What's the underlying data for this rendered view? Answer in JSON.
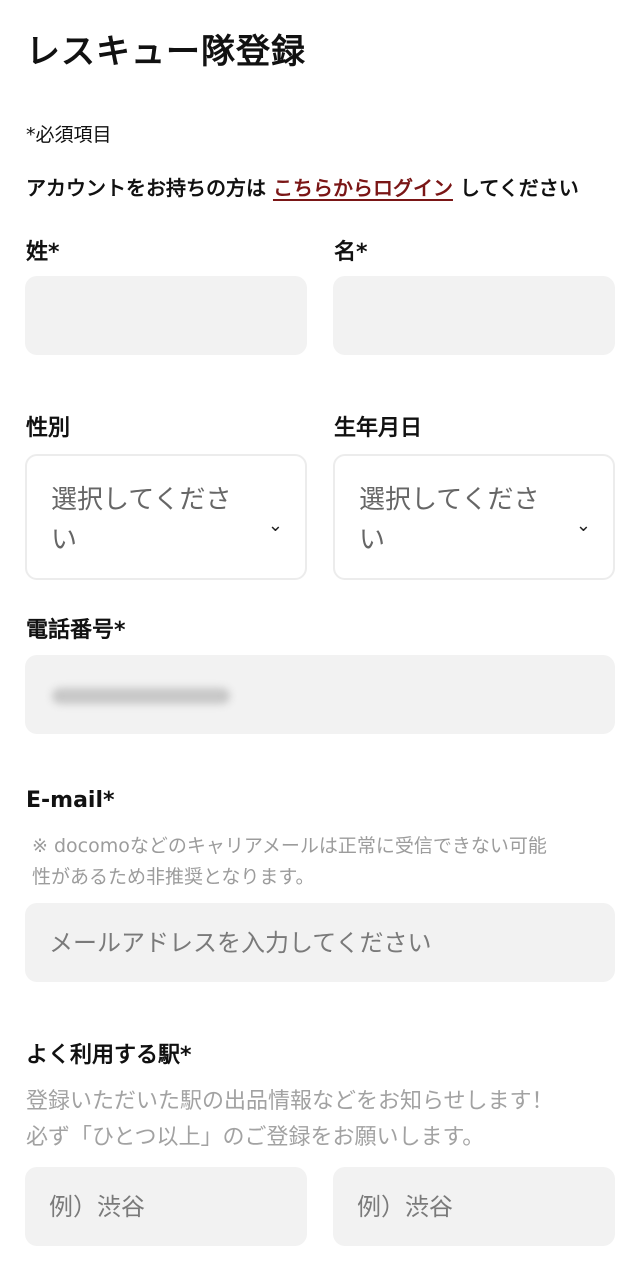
{
  "header": {
    "title": "レスキュー隊登録"
  },
  "required_note": "*必須項目",
  "login": {
    "prefix": "アカウントをお持ちの方は ",
    "link": "こちらからログイン",
    "suffix": " してください"
  },
  "fields": {
    "last_name": {
      "label": "姓*",
      "value": ""
    },
    "first_name": {
      "label": "名*",
      "value": ""
    },
    "gender": {
      "label": "性別",
      "selected": "選択してください"
    },
    "birthdate": {
      "label": "生年月日",
      "selected": "選択してください"
    },
    "phone": {
      "label": "電話番号*"
    },
    "email": {
      "label": "E-mail*",
      "note_line1": "※ docomoなどのキャリアメールは正常に受信できない可能",
      "note_line2": "性があるため非推奨となります。",
      "placeholder": "メールアドレスを入力してください"
    },
    "station": {
      "label": "よく利用する駅*",
      "note_line1": "登録いただいた駅の出品情報などをお知らせします！",
      "note_line2": "必ず「ひとつ以上」のご登録をお願いします。",
      "placeholder1": "例）渋谷",
      "placeholder2": "例）渋谷"
    }
  },
  "icons": {
    "select_chevron": "chevron-down-icon"
  }
}
